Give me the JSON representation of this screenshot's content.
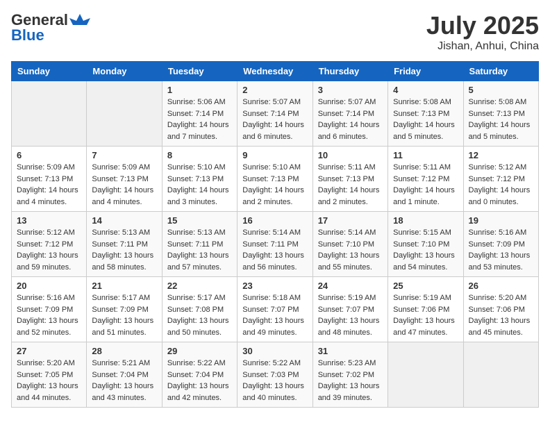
{
  "header": {
    "logo_line1": "General",
    "logo_line2": "Blue",
    "title": "July 2025",
    "location": "Jishan, Anhui, China"
  },
  "weekdays": [
    "Sunday",
    "Monday",
    "Tuesday",
    "Wednesday",
    "Thursday",
    "Friday",
    "Saturday"
  ],
  "weeks": [
    [
      {
        "day": "",
        "sunrise": "",
        "sunset": "",
        "daylight": ""
      },
      {
        "day": "",
        "sunrise": "",
        "sunset": "",
        "daylight": ""
      },
      {
        "day": "1",
        "sunrise": "Sunrise: 5:06 AM",
        "sunset": "Sunset: 7:14 PM",
        "daylight": "Daylight: 14 hours and 7 minutes."
      },
      {
        "day": "2",
        "sunrise": "Sunrise: 5:07 AM",
        "sunset": "Sunset: 7:14 PM",
        "daylight": "Daylight: 14 hours and 6 minutes."
      },
      {
        "day": "3",
        "sunrise": "Sunrise: 5:07 AM",
        "sunset": "Sunset: 7:14 PM",
        "daylight": "Daylight: 14 hours and 6 minutes."
      },
      {
        "day": "4",
        "sunrise": "Sunrise: 5:08 AM",
        "sunset": "Sunset: 7:13 PM",
        "daylight": "Daylight: 14 hours and 5 minutes."
      },
      {
        "day": "5",
        "sunrise": "Sunrise: 5:08 AM",
        "sunset": "Sunset: 7:13 PM",
        "daylight": "Daylight: 14 hours and 5 minutes."
      }
    ],
    [
      {
        "day": "6",
        "sunrise": "Sunrise: 5:09 AM",
        "sunset": "Sunset: 7:13 PM",
        "daylight": "Daylight: 14 hours and 4 minutes."
      },
      {
        "day": "7",
        "sunrise": "Sunrise: 5:09 AM",
        "sunset": "Sunset: 7:13 PM",
        "daylight": "Daylight: 14 hours and 4 minutes."
      },
      {
        "day": "8",
        "sunrise": "Sunrise: 5:10 AM",
        "sunset": "Sunset: 7:13 PM",
        "daylight": "Daylight: 14 hours and 3 minutes."
      },
      {
        "day": "9",
        "sunrise": "Sunrise: 5:10 AM",
        "sunset": "Sunset: 7:13 PM",
        "daylight": "Daylight: 14 hours and 2 minutes."
      },
      {
        "day": "10",
        "sunrise": "Sunrise: 5:11 AM",
        "sunset": "Sunset: 7:13 PM",
        "daylight": "Daylight: 14 hours and 2 minutes."
      },
      {
        "day": "11",
        "sunrise": "Sunrise: 5:11 AM",
        "sunset": "Sunset: 7:12 PM",
        "daylight": "Daylight: 14 hours and 1 minute."
      },
      {
        "day": "12",
        "sunrise": "Sunrise: 5:12 AM",
        "sunset": "Sunset: 7:12 PM",
        "daylight": "Daylight: 14 hours and 0 minutes."
      }
    ],
    [
      {
        "day": "13",
        "sunrise": "Sunrise: 5:12 AM",
        "sunset": "Sunset: 7:12 PM",
        "daylight": "Daylight: 13 hours and 59 minutes."
      },
      {
        "day": "14",
        "sunrise": "Sunrise: 5:13 AM",
        "sunset": "Sunset: 7:11 PM",
        "daylight": "Daylight: 13 hours and 58 minutes."
      },
      {
        "day": "15",
        "sunrise": "Sunrise: 5:13 AM",
        "sunset": "Sunset: 7:11 PM",
        "daylight": "Daylight: 13 hours and 57 minutes."
      },
      {
        "day": "16",
        "sunrise": "Sunrise: 5:14 AM",
        "sunset": "Sunset: 7:11 PM",
        "daylight": "Daylight: 13 hours and 56 minutes."
      },
      {
        "day": "17",
        "sunrise": "Sunrise: 5:14 AM",
        "sunset": "Sunset: 7:10 PM",
        "daylight": "Daylight: 13 hours and 55 minutes."
      },
      {
        "day": "18",
        "sunrise": "Sunrise: 5:15 AM",
        "sunset": "Sunset: 7:10 PM",
        "daylight": "Daylight: 13 hours and 54 minutes."
      },
      {
        "day": "19",
        "sunrise": "Sunrise: 5:16 AM",
        "sunset": "Sunset: 7:09 PM",
        "daylight": "Daylight: 13 hours and 53 minutes."
      }
    ],
    [
      {
        "day": "20",
        "sunrise": "Sunrise: 5:16 AM",
        "sunset": "Sunset: 7:09 PM",
        "daylight": "Daylight: 13 hours and 52 minutes."
      },
      {
        "day": "21",
        "sunrise": "Sunrise: 5:17 AM",
        "sunset": "Sunset: 7:09 PM",
        "daylight": "Daylight: 13 hours and 51 minutes."
      },
      {
        "day": "22",
        "sunrise": "Sunrise: 5:17 AM",
        "sunset": "Sunset: 7:08 PM",
        "daylight": "Daylight: 13 hours and 50 minutes."
      },
      {
        "day": "23",
        "sunrise": "Sunrise: 5:18 AM",
        "sunset": "Sunset: 7:07 PM",
        "daylight": "Daylight: 13 hours and 49 minutes."
      },
      {
        "day": "24",
        "sunrise": "Sunrise: 5:19 AM",
        "sunset": "Sunset: 7:07 PM",
        "daylight": "Daylight: 13 hours and 48 minutes."
      },
      {
        "day": "25",
        "sunrise": "Sunrise: 5:19 AM",
        "sunset": "Sunset: 7:06 PM",
        "daylight": "Daylight: 13 hours and 47 minutes."
      },
      {
        "day": "26",
        "sunrise": "Sunrise: 5:20 AM",
        "sunset": "Sunset: 7:06 PM",
        "daylight": "Daylight: 13 hours and 45 minutes."
      }
    ],
    [
      {
        "day": "27",
        "sunrise": "Sunrise: 5:20 AM",
        "sunset": "Sunset: 7:05 PM",
        "daylight": "Daylight: 13 hours and 44 minutes."
      },
      {
        "day": "28",
        "sunrise": "Sunrise: 5:21 AM",
        "sunset": "Sunset: 7:04 PM",
        "daylight": "Daylight: 13 hours and 43 minutes."
      },
      {
        "day": "29",
        "sunrise": "Sunrise: 5:22 AM",
        "sunset": "Sunset: 7:04 PM",
        "daylight": "Daylight: 13 hours and 42 minutes."
      },
      {
        "day": "30",
        "sunrise": "Sunrise: 5:22 AM",
        "sunset": "Sunset: 7:03 PM",
        "daylight": "Daylight: 13 hours and 40 minutes."
      },
      {
        "day": "31",
        "sunrise": "Sunrise: 5:23 AM",
        "sunset": "Sunset: 7:02 PM",
        "daylight": "Daylight: 13 hours and 39 minutes."
      },
      {
        "day": "",
        "sunrise": "",
        "sunset": "",
        "daylight": ""
      },
      {
        "day": "",
        "sunrise": "",
        "sunset": "",
        "daylight": ""
      }
    ]
  ]
}
